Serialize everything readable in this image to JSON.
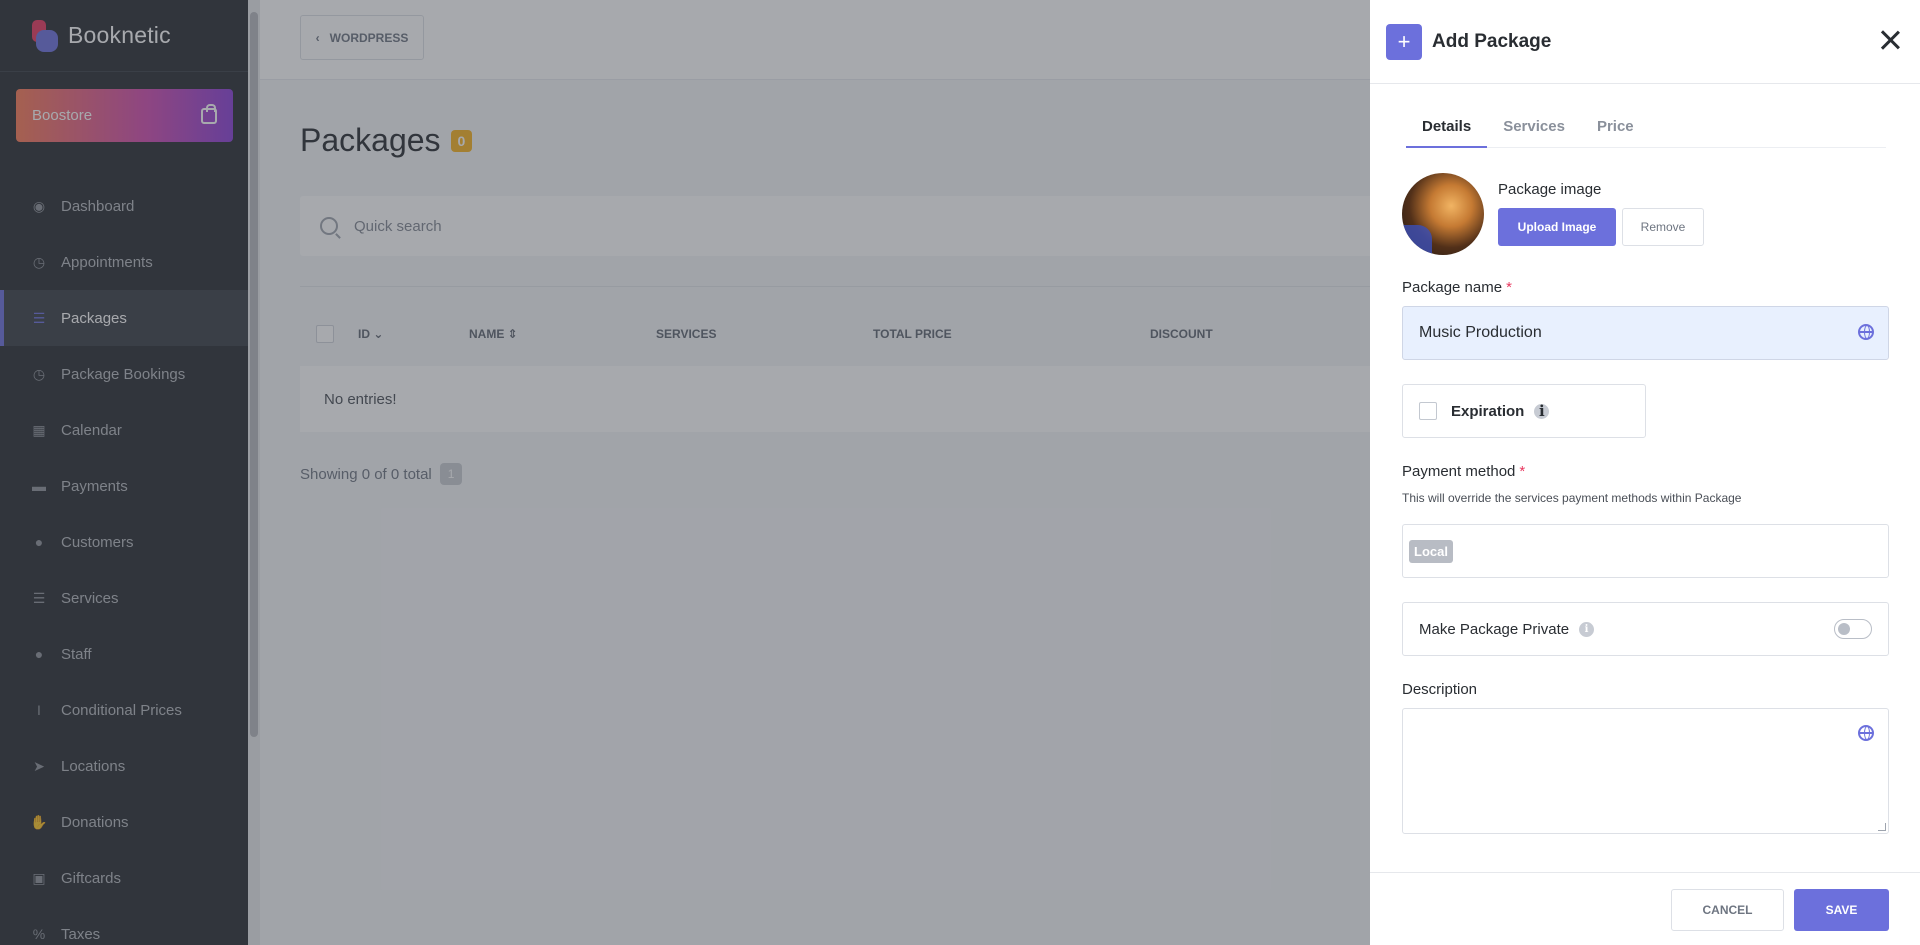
{
  "app": {
    "name": "Booknetic"
  },
  "boostore": {
    "label": "Boostore"
  },
  "sidebar": {
    "items": [
      {
        "label": "Dashboard",
        "icon": "dashboard-icon"
      },
      {
        "label": "Appointments",
        "icon": "clock-icon"
      },
      {
        "label": "Packages",
        "icon": "list-icon",
        "active": true
      },
      {
        "label": "Package Bookings",
        "icon": "clock-icon"
      },
      {
        "label": "Calendar",
        "icon": "calendar-icon"
      },
      {
        "label": "Payments",
        "icon": "wallet-icon"
      },
      {
        "label": "Customers",
        "icon": "users-icon"
      },
      {
        "label": "Services",
        "icon": "list-icon"
      },
      {
        "label": "Staff",
        "icon": "user-icon"
      },
      {
        "label": "Conditional Prices",
        "icon": "cursor-icon"
      },
      {
        "label": "Locations",
        "icon": "send-icon"
      },
      {
        "label": "Donations",
        "icon": "hand-icon"
      },
      {
        "label": "Giftcards",
        "icon": "gift-icon"
      },
      {
        "label": "Taxes",
        "icon": "percent-icon"
      }
    ]
  },
  "topbar": {
    "wordpress_label": "WORDPRESS"
  },
  "page": {
    "title": "Packages",
    "count": "0",
    "search_placeholder": "Quick search",
    "columns": [
      "ID",
      "NAME",
      "SERVICES",
      "TOTAL PRICE",
      "DISCOUNT"
    ],
    "empty_text": "No entries!",
    "showing_text": "Showing 0 of 0 total",
    "page_number": "1"
  },
  "panel": {
    "title": "Add Package",
    "tabs": [
      "Details",
      "Services",
      "Price"
    ],
    "package_image_label": "Package image",
    "upload_label": "Upload Image",
    "remove_label": "Remove",
    "package_name_label": "Package name",
    "package_name_value": "Music Production",
    "required_mark": "*",
    "expiration_label": "Expiration",
    "info_glyph": "i",
    "payment_method_label": "Payment method",
    "payment_method_hint": "This will override the services payment methods within Package",
    "payment_method_tag": "Local",
    "private_label": "Make Package Private",
    "private_enabled": false,
    "description_label": "Description",
    "description_value": "",
    "cancel_label": "CANCEL",
    "save_label": "SAVE"
  },
  "colors": {
    "accent": "#6c70dc",
    "sidebar_bg": "#292d32",
    "badge": "#f8b31f",
    "required": "#e8385f"
  }
}
